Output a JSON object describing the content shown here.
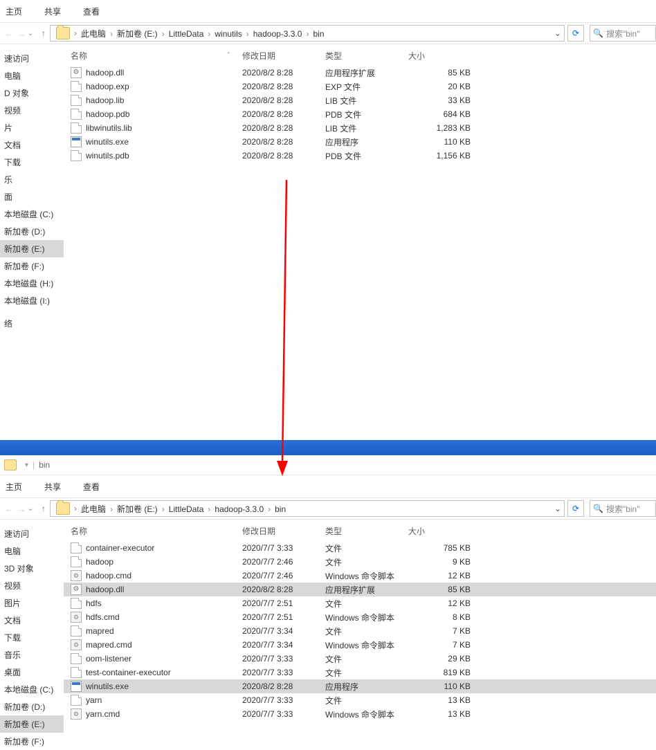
{
  "tabs": {
    "home": "主页",
    "share": "共享",
    "view": "查看"
  },
  "breadcrumb1": [
    "此电脑",
    "新加卷 (E:)",
    "LittleData",
    "winutils",
    "hadoop-3.3.0",
    "bin"
  ],
  "breadcrumb2": [
    "此电脑",
    "新加卷 (E:)",
    "LittleData",
    "hadoop-3.3.0",
    "bin"
  ],
  "search_placeholder": "搜索\"bin\"",
  "cols": {
    "name": "名称",
    "date": "修改日期",
    "type": "类型",
    "size": "大小"
  },
  "tree_common": [
    "速访问",
    "电脑",
    "D 对象",
    "视频",
    "片",
    "文档",
    "下载",
    "乐",
    "面",
    "本地磁盘 (C:)",
    "新加卷 (D:)",
    "新加卷 (E:)",
    "新加卷 (F:)",
    "本地磁盘 (H:)",
    "本地磁盘 (I:)",
    "",
    "络"
  ],
  "tree1_sel": 11,
  "tree_bottom": [
    "速访问",
    "电脑",
    "3D 对象",
    "视频",
    "图片",
    "文档",
    "下载",
    "音乐",
    "桌面",
    "本地磁盘 (C:)",
    "新加卷 (D:)",
    "新加卷 (E:)",
    "新加卷 (F:)"
  ],
  "tree2_sel": 11,
  "files1": [
    {
      "ico": "gear",
      "name": "hadoop.dll",
      "date": "2020/8/2 8:28",
      "type": "应用程序扩展",
      "size": "85 KB"
    },
    {
      "ico": "file",
      "name": "hadoop.exp",
      "date": "2020/8/2 8:28",
      "type": "EXP 文件",
      "size": "20 KB"
    },
    {
      "ico": "file",
      "name": "hadoop.lib",
      "date": "2020/8/2 8:28",
      "type": "LIB 文件",
      "size": "33 KB"
    },
    {
      "ico": "file",
      "name": "hadoop.pdb",
      "date": "2020/8/2 8:28",
      "type": "PDB 文件",
      "size": "684 KB"
    },
    {
      "ico": "file",
      "name": "libwinutils.lib",
      "date": "2020/8/2 8:28",
      "type": "LIB 文件",
      "size": "1,283 KB"
    },
    {
      "ico": "exe",
      "name": "winutils.exe",
      "date": "2020/8/2 8:28",
      "type": "应用程序",
      "size": "110 KB"
    },
    {
      "ico": "file",
      "name": "winutils.pdb",
      "date": "2020/8/2 8:28",
      "type": "PDB 文件",
      "size": "1,156 KB"
    }
  ],
  "files2": [
    {
      "ico": "file",
      "name": "container-executor",
      "date": "2020/7/7 3:33",
      "type": "文件",
      "size": "785 KB",
      "sel": false
    },
    {
      "ico": "file",
      "name": "hadoop",
      "date": "2020/7/7 2:46",
      "type": "文件",
      "size": "9 KB",
      "sel": false
    },
    {
      "ico": "script",
      "name": "hadoop.cmd",
      "date": "2020/7/7 2:46",
      "type": "Windows 命令脚本",
      "size": "12 KB",
      "sel": false
    },
    {
      "ico": "gear",
      "name": "hadoop.dll",
      "date": "2020/8/2 8:28",
      "type": "应用程序扩展",
      "size": "85 KB",
      "sel": true
    },
    {
      "ico": "file",
      "name": "hdfs",
      "date": "2020/7/7 2:51",
      "type": "文件",
      "size": "12 KB",
      "sel": false
    },
    {
      "ico": "script",
      "name": "hdfs.cmd",
      "date": "2020/7/7 2:51",
      "type": "Windows 命令脚本",
      "size": "8 KB",
      "sel": false
    },
    {
      "ico": "file",
      "name": "mapred",
      "date": "2020/7/7 3:34",
      "type": "文件",
      "size": "7 KB",
      "sel": false
    },
    {
      "ico": "script",
      "name": "mapred.cmd",
      "date": "2020/7/7 3:34",
      "type": "Windows 命令脚本",
      "size": "7 KB",
      "sel": false
    },
    {
      "ico": "file",
      "name": "oom-listener",
      "date": "2020/7/7 3:33",
      "type": "文件",
      "size": "29 KB",
      "sel": false
    },
    {
      "ico": "file",
      "name": "test-container-executor",
      "date": "2020/7/7 3:33",
      "type": "文件",
      "size": "819 KB",
      "sel": false
    },
    {
      "ico": "exe",
      "name": "winutils.exe",
      "date": "2020/8/2 8:28",
      "type": "应用程序",
      "size": "110 KB",
      "sel": true
    },
    {
      "ico": "file",
      "name": "yarn",
      "date": "2020/7/7 3:33",
      "type": "文件",
      "size": "13 KB",
      "sel": false
    },
    {
      "ico": "script",
      "name": "yarn.cmd",
      "date": "2020/7/7 3:33",
      "type": "Windows 命令脚本",
      "size": "13 KB",
      "sel": false
    }
  ],
  "title2": "bin"
}
